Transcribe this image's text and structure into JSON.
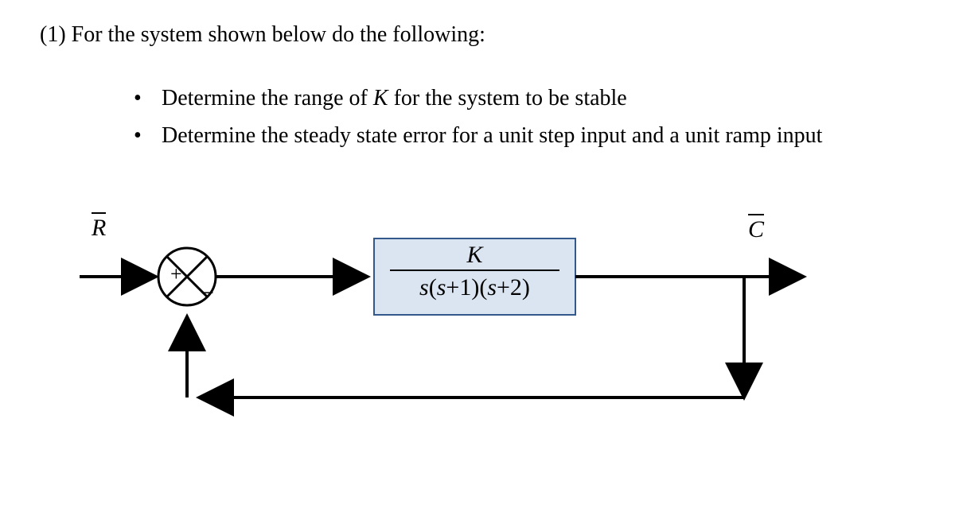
{
  "problem": {
    "number": "(1)",
    "prompt": "For the system shown below do the following:",
    "tasks": [
      "Determine the range of K for the system to be stable",
      "Determine the steady state error for a unit step input and a unit ramp input"
    ],
    "variable": "K"
  },
  "diagram": {
    "input_label": "R",
    "output_label": "C",
    "summing_plus": "+",
    "summing_minus": "−",
    "transfer_function": {
      "numerator": "K",
      "denominator": "s(s+1)(s+2)"
    },
    "feedback": "unity",
    "colors": {
      "line": "#000000",
      "block_border": "#33588c",
      "block_fill": "#dbe5f1",
      "page_bg": "#ffffff"
    }
  }
}
